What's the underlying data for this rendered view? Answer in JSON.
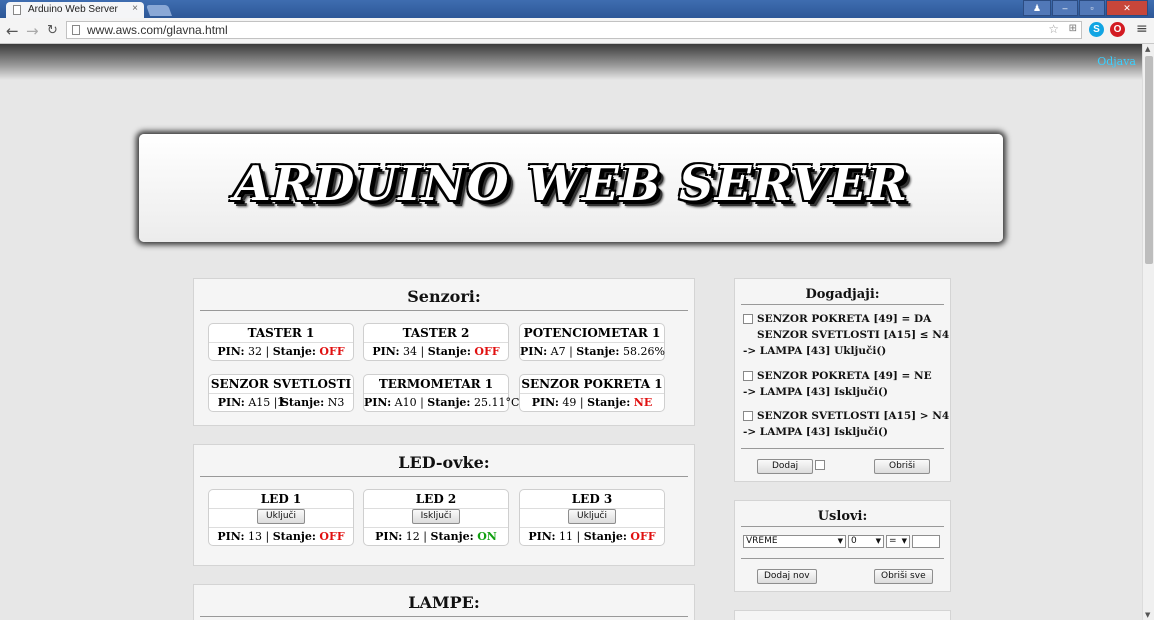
{
  "browser": {
    "tab_title": "Arduino Web Server",
    "url": "www.aws.com/glavna.html",
    "back_icon": "←",
    "forward_icon": "→",
    "reload_icon": "C",
    "close_tab_icon": "×"
  },
  "header": {
    "logout_label": "Odjava",
    "banner_title": "ARDUINO WEB SERVER"
  },
  "senzori": {
    "title": "Senzori:",
    "pin_label": "PIN:",
    "state_label": "Stanje:",
    "cards": [
      {
        "name": "TASTER 1",
        "pin": "32",
        "state": "OFF"
      },
      {
        "name": "TASTER 2",
        "pin": "34",
        "state": "OFF"
      },
      {
        "name": "POTENCIOMETAR 1",
        "pin": "A7",
        "state": "58.26%"
      },
      {
        "name": "SENZOR SVETLOSTI 1",
        "pin": "A15",
        "state": "N3"
      },
      {
        "name": "TERMOMETAR 1",
        "pin": "A10",
        "state": "25.11°C"
      },
      {
        "name": "SENZOR POKRETA 1",
        "pin": "49",
        "state": "NE"
      }
    ]
  },
  "led": {
    "title": "LED-ovke:",
    "cards": [
      {
        "name": "LED 1",
        "button": "Uključi",
        "pin": "13",
        "state": "OFF"
      },
      {
        "name": "LED 2",
        "button": "Isključi",
        "pin": "12",
        "state": "ON"
      },
      {
        "name": "LED 3",
        "button": "Uključi",
        "pin": "11",
        "state": "OFF"
      }
    ]
  },
  "lampe": {
    "title": "LAMPE:"
  },
  "dogadjaji": {
    "title": "Dogadjaji:",
    "events": [
      {
        "line1": "SENZOR POKRETA [49] = DA",
        "line2": "SENZOR SVETLOSTI [A15] ≤ N4",
        "line3": "-> LAMPA [43] Uključi()"
      },
      {
        "line1": "SENZOR POKRETA [49] = NE",
        "line2": "-> LAMPA [43] Isključi()"
      },
      {
        "line1": "SENZOR SVETLOSTI [A15] > N4",
        "line2": "-> LAMPA [43] Isključi()"
      }
    ],
    "add_label": "Dodaj",
    "delete_label": "Obriši"
  },
  "uslovi": {
    "title": "Uslovi:",
    "select_type": "VREME",
    "select_value": "0",
    "select_op": "=",
    "add_label": "Dodaj nov",
    "delete_all_label": "Obriši sve"
  },
  "colors": {
    "off": "#e01010",
    "on": "#12a012",
    "logout_link": "#3ad0ff"
  }
}
